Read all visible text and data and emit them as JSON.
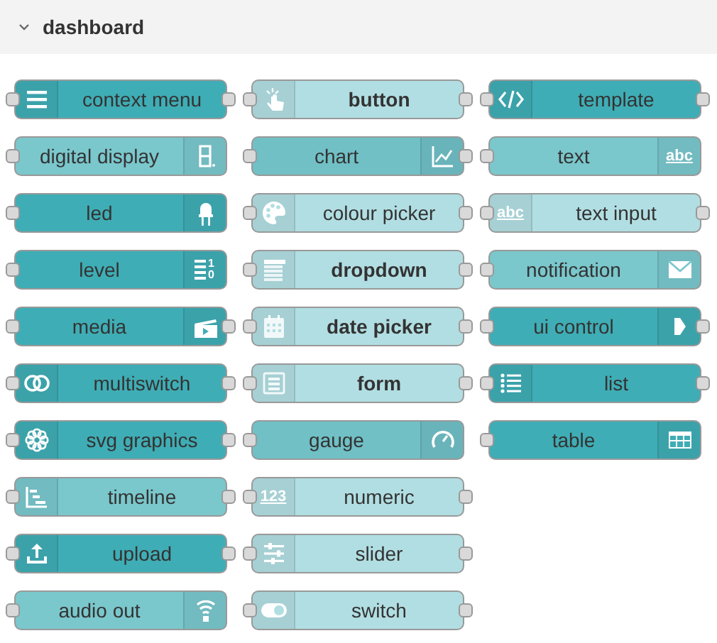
{
  "category": {
    "title": "dashboard",
    "expanded": true
  },
  "columns": [
    [
      {
        "label": "context menu",
        "kind": "menu",
        "color": "#3fadb5",
        "icon_right": false,
        "input": true,
        "output": true,
        "emphasized": false
      },
      {
        "label": "digital display",
        "kind": "digit",
        "color": "#7ac7cc",
        "icon_right": true,
        "input": true,
        "output": false,
        "emphasized": false
      },
      {
        "label": "led",
        "kind": "led",
        "color": "#3fadb5",
        "icon_right": true,
        "input": true,
        "output": false,
        "emphasized": false
      },
      {
        "label": "level",
        "kind": "level",
        "color": "#3fadb5",
        "icon_right": true,
        "input": true,
        "output": false,
        "emphasized": false,
        "icon_text": "1 0"
      },
      {
        "label": "media",
        "kind": "clapper",
        "color": "#3fadb5",
        "icon_right": true,
        "input": true,
        "output": true,
        "emphasized": false
      },
      {
        "label": "multiswitch",
        "kind": "rings",
        "color": "#3fadb5",
        "icon_right": false,
        "input": true,
        "output": true,
        "emphasized": false
      },
      {
        "label": "svg graphics",
        "kind": "flower",
        "color": "#3fadb5",
        "icon_right": false,
        "input": true,
        "output": true,
        "emphasized": false
      },
      {
        "label": "timeline",
        "kind": "timeline",
        "color": "#7ac7cc",
        "icon_right": false,
        "input": true,
        "output": true,
        "emphasized": false
      },
      {
        "label": "upload",
        "kind": "upload",
        "color": "#3fadb5",
        "icon_right": false,
        "input": true,
        "output": true,
        "emphasized": false
      },
      {
        "label": "audio out",
        "kind": "broadcast",
        "color": "#7ac7cc",
        "icon_right": true,
        "input": true,
        "output": false,
        "emphasized": false
      }
    ],
    [
      {
        "label": "button",
        "kind": "hand",
        "color": "#b1dee2",
        "icon_right": false,
        "input": true,
        "output": true,
        "emphasized": true
      },
      {
        "label": "chart",
        "kind": "chart",
        "color": "#70c0c6",
        "icon_right": true,
        "input": true,
        "output": true,
        "emphasized": false
      },
      {
        "label": "colour picker",
        "kind": "palette",
        "color": "#b1dee2",
        "icon_right": false,
        "input": true,
        "output": true,
        "emphasized": false
      },
      {
        "label": "dropdown",
        "kind": "dropdown",
        "color": "#b1dee2",
        "icon_right": false,
        "input": true,
        "output": true,
        "emphasized": true
      },
      {
        "label": "date picker",
        "kind": "calendar",
        "color": "#b1dee2",
        "icon_right": false,
        "input": true,
        "output": true,
        "emphasized": true
      },
      {
        "label": "form",
        "kind": "form",
        "color": "#b1dee2",
        "icon_right": false,
        "input": true,
        "output": true,
        "emphasized": true
      },
      {
        "label": "gauge",
        "kind": "gauge",
        "color": "#70c0c6",
        "icon_right": true,
        "input": true,
        "output": false,
        "emphasized": false
      },
      {
        "label": "numeric",
        "kind": "text",
        "color": "#b1dee2",
        "icon_right": false,
        "input": true,
        "output": true,
        "emphasized": false,
        "icon_text": "123"
      },
      {
        "label": "slider",
        "kind": "sliders",
        "color": "#b1dee2",
        "icon_right": false,
        "input": true,
        "output": true,
        "emphasized": false
      },
      {
        "label": "switch",
        "kind": "toggle",
        "color": "#b1dee2",
        "icon_right": false,
        "input": true,
        "output": true,
        "emphasized": false
      }
    ],
    [
      {
        "label": "template",
        "kind": "code",
        "color": "#3fadb5",
        "icon_right": false,
        "input": true,
        "output": true,
        "emphasized": false
      },
      {
        "label": "text",
        "kind": "text",
        "color": "#7ac7cc",
        "icon_right": true,
        "input": true,
        "output": false,
        "emphasized": false,
        "icon_text": "abc"
      },
      {
        "label": "text input",
        "kind": "text",
        "color": "#b1dee2",
        "icon_right": false,
        "input": true,
        "output": true,
        "emphasized": false,
        "icon_text": "abc"
      },
      {
        "label": "notification",
        "kind": "envelope",
        "color": "#7ac7cc",
        "icon_right": true,
        "input": true,
        "output": false,
        "emphasized": false
      },
      {
        "label": "ui control",
        "kind": "arrow",
        "color": "#3fadb5",
        "icon_right": true,
        "input": true,
        "output": true,
        "emphasized": false
      },
      {
        "label": "list",
        "kind": "list",
        "color": "#3fadb5",
        "icon_right": false,
        "input": true,
        "output": true,
        "emphasized": false
      },
      {
        "label": "table",
        "kind": "grid",
        "color": "#3fadb5",
        "icon_right": true,
        "input": true,
        "output": false,
        "emphasized": false
      }
    ]
  ]
}
